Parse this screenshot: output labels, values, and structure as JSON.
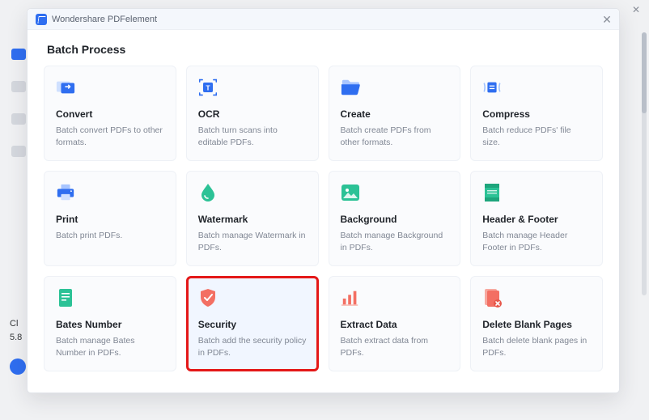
{
  "app_title": "Wondershare PDFelement",
  "bg_left": {
    "line1": "Cl",
    "line2": "5.8"
  },
  "modal": {
    "heading": "Batch Process",
    "cards": [
      {
        "id": "convert",
        "title": "Convert",
        "desc": "Batch convert PDFs to other formats."
      },
      {
        "id": "ocr",
        "title": "OCR",
        "desc": "Batch turn scans into editable PDFs."
      },
      {
        "id": "create",
        "title": "Create",
        "desc": "Batch create PDFs from other formats."
      },
      {
        "id": "compress",
        "title": "Compress",
        "desc": "Batch reduce PDFs' file size."
      },
      {
        "id": "print",
        "title": "Print",
        "desc": "Batch print PDFs."
      },
      {
        "id": "watermark",
        "title": "Watermark",
        "desc": "Batch manage Watermark in PDFs."
      },
      {
        "id": "background",
        "title": "Background",
        "desc": "Batch manage Background in PDFs."
      },
      {
        "id": "headerfooter",
        "title": "Header & Footer",
        "desc": "Batch manage Header  Footer in PDFs."
      },
      {
        "id": "bates",
        "title": "Bates Number",
        "desc": "Batch manage Bates Number in PDFs."
      },
      {
        "id": "security",
        "title": "Security",
        "desc": "Batch add the security policy in PDFs."
      },
      {
        "id": "extract",
        "title": "Extract Data",
        "desc": "Batch extract data from PDFs."
      },
      {
        "id": "deleteblank",
        "title": "Delete Blank Pages",
        "desc": "Batch delete blank pages in PDFs."
      }
    ]
  }
}
